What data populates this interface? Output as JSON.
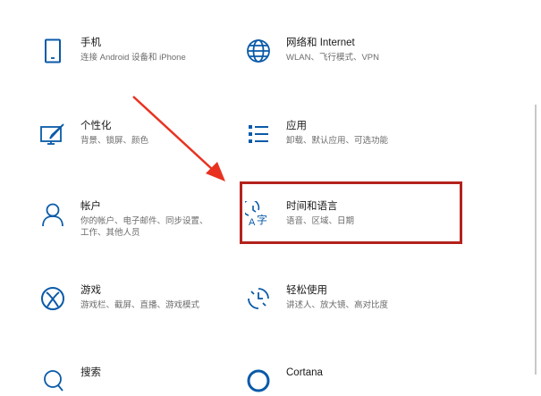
{
  "tiles": [
    {
      "title": "手机",
      "desc": "连接 Android 设备和 iPhone",
      "icon": "phone-icon"
    },
    {
      "title": "网络和 Internet",
      "desc": "WLAN、飞行模式、VPN",
      "icon": "globe-icon"
    },
    {
      "title": "个性化",
      "desc": "背景、锁屏、颜色",
      "icon": "personalization-icon"
    },
    {
      "title": "应用",
      "desc": "卸载、默认应用、可选功能",
      "icon": "apps-list-icon"
    },
    {
      "title": "帐户",
      "desc": "你的帐户、电子邮件、同步设置、工作、其他人员",
      "icon": "person-icon"
    },
    {
      "title": "时间和语言",
      "desc": "语音、区域、日期",
      "icon": "time-language-icon"
    },
    {
      "title": "游戏",
      "desc": "游戏栏、截屏、直播、游戏模式",
      "icon": "xbox-icon"
    },
    {
      "title": "轻松使用",
      "desc": "讲述人、放大镜、高对比度",
      "icon": "ease-of-access-icon"
    },
    {
      "title": "搜索",
      "desc": "",
      "icon": "search-icon"
    },
    {
      "title": "Cortana",
      "desc": "",
      "icon": "cortana-icon"
    }
  ],
  "colors": {
    "icon": "#0a5aa8",
    "highlight": "#b3231d",
    "arrow": "#e8321f"
  }
}
